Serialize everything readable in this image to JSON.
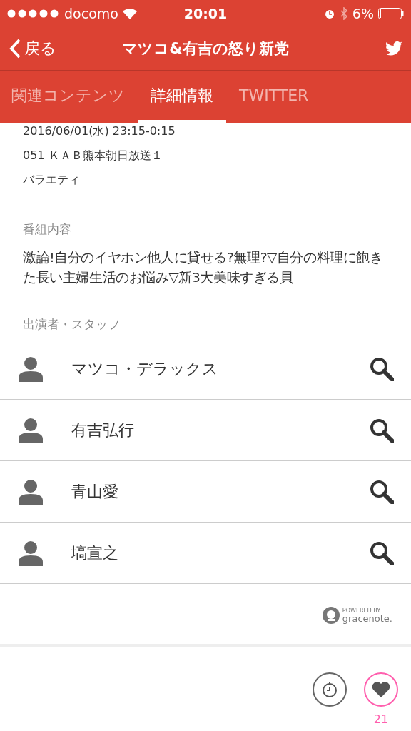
{
  "status_bar": {
    "carrier": "docomo",
    "time": "20:01",
    "battery": "6%"
  },
  "nav": {
    "back": "戻る",
    "title": "マツコ&有吉の怒り新党"
  },
  "tabs": [
    {
      "label": "関連コンテンツ",
      "selected": false
    },
    {
      "label": "詳細情報",
      "selected": true
    },
    {
      "label": "TWITTER",
      "selected": false
    }
  ],
  "details": [
    "2016/06/01(水) 23:15-0:15",
    "051 ＫＡＢ熊本朝日放送１",
    "バラエティ"
  ],
  "synopsis": {
    "heading": "番組内容",
    "text": "激論!自分のイヤホン他人に貸せる?無理?▽自分の料理に飽きた長い主婦生活のお悩み▽新3大美味すぎる貝"
  },
  "cast": {
    "heading": "出演者・スタッフ",
    "people": [
      {
        "name": "マツコ・デラックス"
      },
      {
        "name": "有吉弘行"
      },
      {
        "name": "青山愛"
      },
      {
        "name": "塙宣之"
      }
    ]
  },
  "credit": {
    "powered_by": "POWERED BY",
    "brand": "gracenote."
  },
  "footer": {
    "favorited": true,
    "favorite_count": "21"
  }
}
